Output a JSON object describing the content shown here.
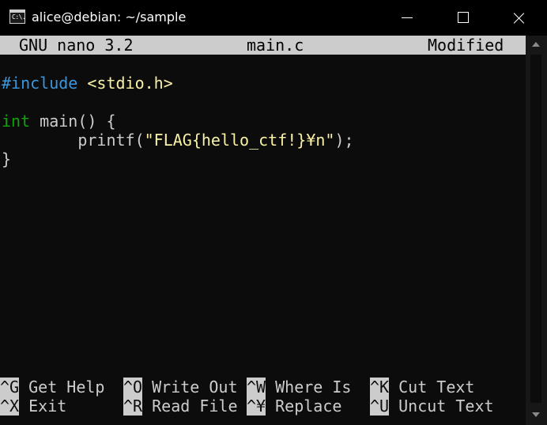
{
  "window": {
    "title": "alice@debian: ~/sample",
    "icon_label": "C:\\."
  },
  "nano": {
    "version": "GNU nano 3.2",
    "filename": "main.c",
    "status": "Modified"
  },
  "code": {
    "line1": {
      "directive": "#include",
      "space": " ",
      "header": "<stdio.h>"
    },
    "line3": {
      "type": "int",
      "rest": " main() {"
    },
    "line4": {
      "indent": "        printf(",
      "string": "\"FLAG{hello_ctf!}¥n\"",
      "end": ");"
    },
    "line5": {
      "brace": "}"
    }
  },
  "shortcuts": {
    "row1": [
      {
        "key": "^G",
        "label": " Get Help"
      },
      {
        "key": "^O",
        "label": " Write Out"
      },
      {
        "key": "^W",
        "label": " Where Is"
      },
      {
        "key": "^K",
        "label": " Cut Text"
      }
    ],
    "row2": [
      {
        "key": "^X",
        "label": " Exit"
      },
      {
        "key": "^R",
        "label": " Read File"
      },
      {
        "key": "^¥",
        "label": " Replace"
      },
      {
        "key": "^U",
        "label": " Uncut Text"
      }
    ]
  },
  "colors": {
    "background": "#0c0c0c",
    "header_bar": "#cccccc",
    "preprocessor": "#3a96dd",
    "type_keyword": "#13a10e",
    "string": "#f9f1a5"
  },
  "icons": {
    "app": "terminal-icon",
    "minimize": "minimize-icon",
    "maximize": "maximize-icon",
    "close": "close-icon"
  }
}
